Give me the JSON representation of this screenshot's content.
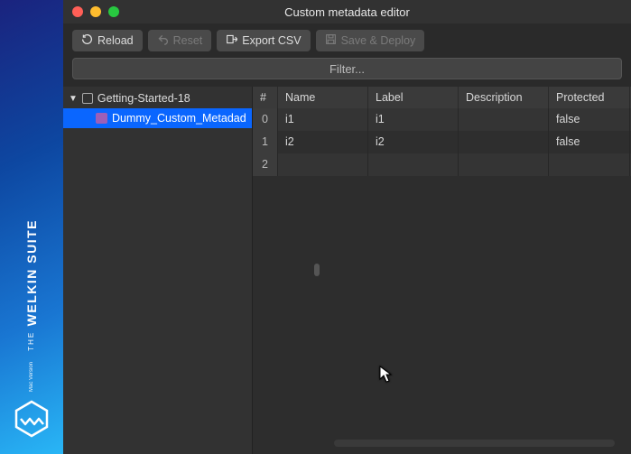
{
  "brand": {
    "the": "THE",
    "name": "WELKIN SUITE",
    "sub": "Mac Version"
  },
  "window": {
    "title": "Custom metadata editor"
  },
  "toolbar": {
    "reload": "Reload",
    "reset": "Reset",
    "export": "Export CSV",
    "save": "Save & Deploy"
  },
  "search": {
    "placeholder": "Filter..."
  },
  "tree": {
    "root": {
      "label": "Getting-Started-18",
      "expanded": true
    },
    "items": [
      {
        "label": "Dummy_Custom_Metadad",
        "selected": true
      }
    ]
  },
  "table": {
    "columns": [
      "#",
      "Name",
      "Label",
      "Description",
      "Protected"
    ],
    "rows": [
      {
        "idx": "0",
        "name": "i1",
        "label": "i1",
        "description": "",
        "protected": "false"
      },
      {
        "idx": "1",
        "name": "i2",
        "label": "i2",
        "description": "",
        "protected": "false"
      },
      {
        "idx": "2",
        "name": "",
        "label": "",
        "description": "",
        "protected": ""
      }
    ]
  }
}
